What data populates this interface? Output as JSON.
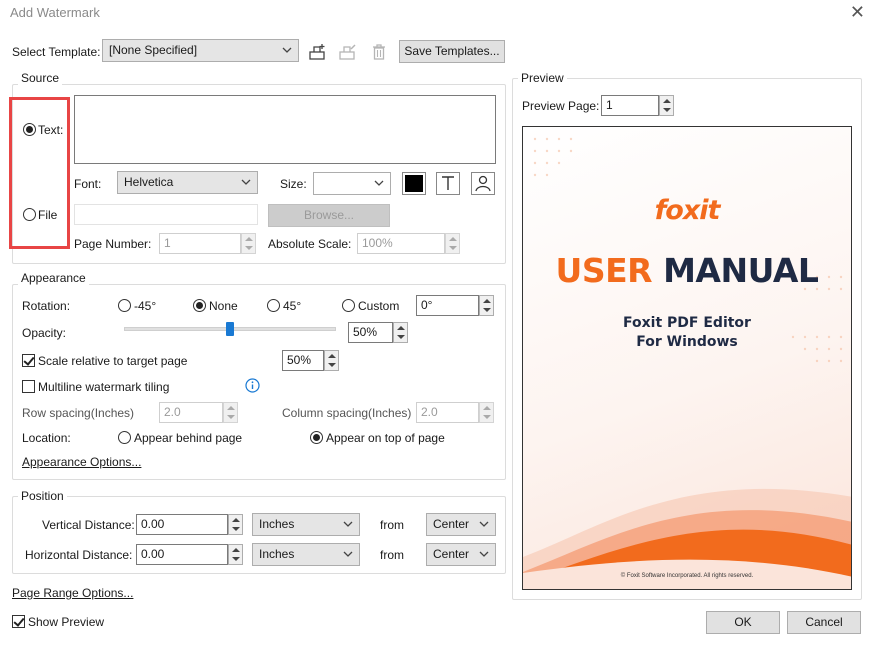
{
  "window": {
    "title": "Add Watermark",
    "close_glyph": "✕"
  },
  "template": {
    "label": "Select Template:",
    "value": "[None Specified]",
    "save_label": "Save Templates..."
  },
  "source": {
    "group_label": "Source",
    "text_option": "Text:",
    "file_option": "File",
    "selected": "text",
    "text_value": "",
    "font_label": "Font:",
    "font_value": "Helvetica",
    "size_label": "Size:",
    "size_value": "",
    "color": "#000000",
    "browse_label": "Browse...",
    "file_path": "",
    "page_number_label": "Page Number:",
    "page_number_value": "1",
    "absolute_scale_label": "Absolute Scale:",
    "absolute_scale_value": "100%"
  },
  "appearance": {
    "group_label": "Appearance",
    "rotation_label": "Rotation:",
    "rotation_options": [
      "-45°",
      "None",
      "45°",
      "Custom"
    ],
    "rotation_selected": "None",
    "rotation_custom_value": "0°",
    "opacity_label": "Opacity:",
    "opacity_value": "50%",
    "opacity_level": 0.5,
    "scale_label": "Scale relative to target page",
    "scale_checked": true,
    "scale_value": "50%",
    "tiling_label": "Multiline watermark tiling",
    "tiling_checked": false,
    "row_spacing_label": "Row spacing(Inches)",
    "row_spacing_value": "2.0",
    "column_spacing_label": "Column spacing(Inches)",
    "column_spacing_value": "2.0",
    "location_label": "Location:",
    "location_behind": "Appear behind page",
    "location_top": "Appear on top of page",
    "location_selected": "top",
    "options_link": "Appearance Options..."
  },
  "position": {
    "group_label": "Position",
    "vertical_label": "Vertical Distance:",
    "vertical_value": "0.00",
    "vertical_unit": "Inches",
    "vertical_from": "Center",
    "horizontal_label": "Horizontal Distance:",
    "horizontal_value": "0.00",
    "horizontal_unit": "Inches",
    "horizontal_from": "Center",
    "from_label": "from"
  },
  "page_range_link": "Page Range Options...",
  "show_preview": {
    "label": "Show Preview",
    "checked": true
  },
  "preview": {
    "group_label": "Preview",
    "page_label": "Preview Page:",
    "page_value": "1",
    "doc_logo": "foxit",
    "doc_title_1": "USER",
    "doc_title_2": "MANUAL",
    "doc_subtitle_1": "Foxit PDF Editor",
    "doc_subtitle_2": "For Windows",
    "doc_copyright": "© Foxit Software Incorporated. All rights reserved.",
    "accent": "#f26b1d",
    "navy": "#1f2a44"
  },
  "buttons": {
    "ok": "OK",
    "cancel": "Cancel"
  }
}
